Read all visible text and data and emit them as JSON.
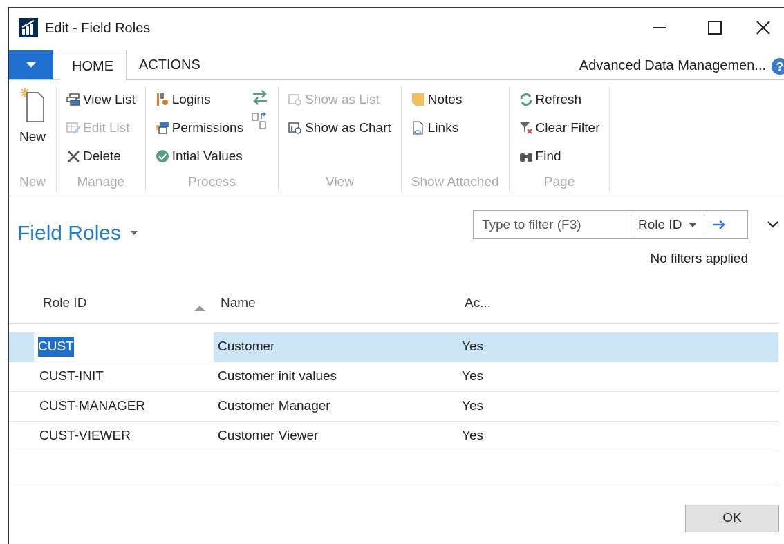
{
  "window": {
    "title": "Edit - Field Roles"
  },
  "tabs": [
    {
      "label": "HOME",
      "selected": true
    },
    {
      "label": "ACTIONS",
      "selected": false
    }
  ],
  "company": "Advanced Data Managemen...",
  "help": "?",
  "ribbon": [
    {
      "name": "New",
      "items": [
        {
          "label": "New",
          "disabled": false,
          "kind": "large"
        }
      ]
    },
    {
      "name": "Manage",
      "items": [
        {
          "label": "View List",
          "disabled": false,
          "kind": "small"
        },
        {
          "label": "Edit List",
          "disabled": true,
          "kind": "small"
        },
        {
          "label": "Delete",
          "disabled": false,
          "kind": "small"
        }
      ]
    },
    {
      "name": "Process",
      "items": [
        {
          "label": "Logins",
          "disabled": false,
          "kind": "small"
        },
        {
          "label": "Permissions",
          "disabled": false,
          "kind": "small"
        },
        {
          "label": "Intial Values",
          "disabled": false,
          "kind": "small"
        }
      ]
    },
    {
      "name": "View",
      "items": [
        {
          "label": "Show as List",
          "disabled": true,
          "kind": "small"
        },
        {
          "label": "Show as Chart",
          "disabled": false,
          "kind": "small"
        }
      ]
    },
    {
      "name": "Show Attached",
      "items": [
        {
          "label": "Notes",
          "disabled": false,
          "kind": "small"
        },
        {
          "label": "Links",
          "disabled": false,
          "kind": "small"
        }
      ]
    },
    {
      "name": "Page",
      "items": [
        {
          "label": "Refresh",
          "disabled": false,
          "kind": "small"
        },
        {
          "label": "Clear Filter",
          "disabled": false,
          "kind": "small"
        },
        {
          "label": "Find",
          "disabled": false,
          "kind": "small"
        }
      ]
    }
  ],
  "page_title": "Field Roles",
  "filter": {
    "placeholder": "Type to filter (F3)",
    "field": "Role ID",
    "status": "No filters applied"
  },
  "table": {
    "columns": [
      "Role ID",
      "Name",
      "Ac..."
    ],
    "rows": [
      {
        "cells": [
          "CUST",
          "Customer",
          "Yes"
        ],
        "selected": true
      },
      {
        "cells": [
          "CUST-INIT",
          "Customer init values",
          "Yes"
        ],
        "selected": false
      },
      {
        "cells": [
          "CUST-MANAGER",
          "Customer Manager",
          "Yes"
        ],
        "selected": false
      },
      {
        "cells": [
          "CUST-VIEWER",
          "Customer Viewer",
          "Yes"
        ],
        "selected": false
      }
    ]
  },
  "buttons": [
    "OK"
  ]
}
